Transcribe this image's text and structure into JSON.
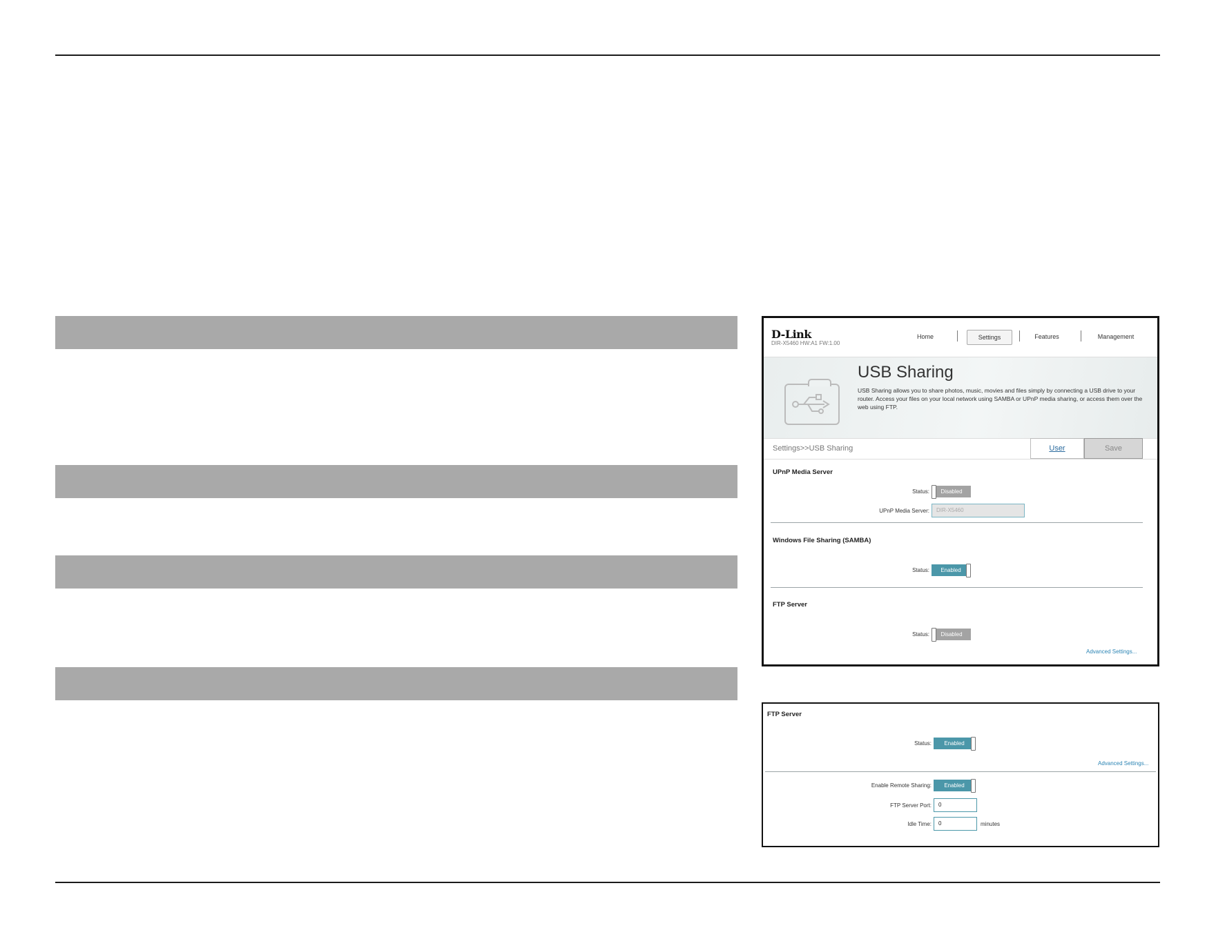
{
  "shot1": {
    "logo": "D-Link",
    "model": "DIR-X5460 HW:A1 FW:1.00",
    "nav": [
      "Home",
      "Settings",
      "Features",
      "Management"
    ],
    "banner": {
      "title": "USB Sharing",
      "description": "USB Sharing allows you to share photos, music, movies and files simply by connecting a USB drive to your router. Access your files on your local network using SAMBA or UPnP media sharing, or access them over the web using FTP."
    },
    "breadcrumb": "Settings>>USB Sharing",
    "user_label": "User",
    "save_label": "Save",
    "upnp": {
      "title": "UPnP Media Server",
      "status_label": "Status:",
      "status_value": "Disabled",
      "server_label": "UPnP Media Server:",
      "server_value": "DIR-X5460"
    },
    "samba": {
      "title": "Windows File Sharing (SAMBA)",
      "status_label": "Status:",
      "status_value": "Enabled"
    },
    "ftp": {
      "title": "FTP Server",
      "status_label": "Status:",
      "status_value": "Disabled",
      "advanced": "Advanced Settings..."
    }
  },
  "shot2": {
    "title": "FTP Server",
    "status_label": "Status:",
    "status_value": "Enabled",
    "advanced": "Advanced Settings...",
    "remote_label": "Enable Remote Sharing:",
    "remote_value": "Enabled",
    "port_label": "FTP Server Port:",
    "port_value": "0",
    "idle_label": "Idle Time:",
    "idle_value": "0",
    "idle_unit": "minutes"
  },
  "colors": {
    "enabled": "#4b97a9",
    "disabled": "#a3a3a3",
    "section_bar": "#a9a9a9",
    "link": "#2b84b4"
  }
}
